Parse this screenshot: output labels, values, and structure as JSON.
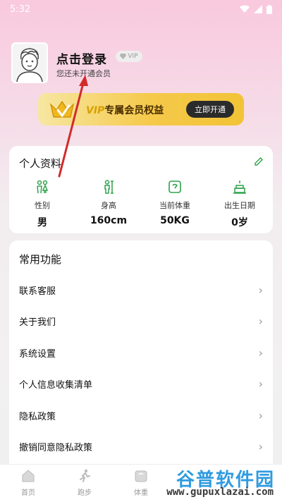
{
  "status_bar": {
    "time": "5:32",
    "icons": [
      "wifi-icon",
      "signal-icon",
      "battery-icon"
    ]
  },
  "profile": {
    "username": "点击登录",
    "vip_chip": "VIP",
    "member_status": "您还未开通会员"
  },
  "vip_banner": {
    "title_vip": "VIP",
    "title_rest": "专属会员权益",
    "button": "立即开通"
  },
  "profile_card": {
    "title": "个人资料",
    "stats": [
      {
        "label": "性别",
        "value": "男",
        "icon": "gender-icon"
      },
      {
        "label": "身高",
        "value": "160cm",
        "icon": "height-icon"
      },
      {
        "label": "当前体重",
        "value": "50KG",
        "icon": "scale-icon"
      },
      {
        "label": "出生日期",
        "value": "0岁",
        "icon": "birthday-cake-icon"
      }
    ]
  },
  "features": {
    "title": "常用功能",
    "items": [
      "联系客服",
      "关于我们",
      "系统设置",
      "个人信息收集清单",
      "隐私政策",
      "撤销同意隐私政策"
    ]
  },
  "tabbar": {
    "tabs": [
      {
        "label": "首页",
        "icon": "home-icon"
      },
      {
        "label": "跑步",
        "icon": "running-icon"
      },
      {
        "label": "体重",
        "icon": "scale-icon"
      }
    ]
  },
  "watermark": {
    "title": "谷普软件园",
    "url": "www.gupuxlazai.com"
  },
  "colors": {
    "accent_green": "#2fa24a",
    "vip_gold": "#f5c94a",
    "annotation_arrow": "#d42a2a"
  }
}
